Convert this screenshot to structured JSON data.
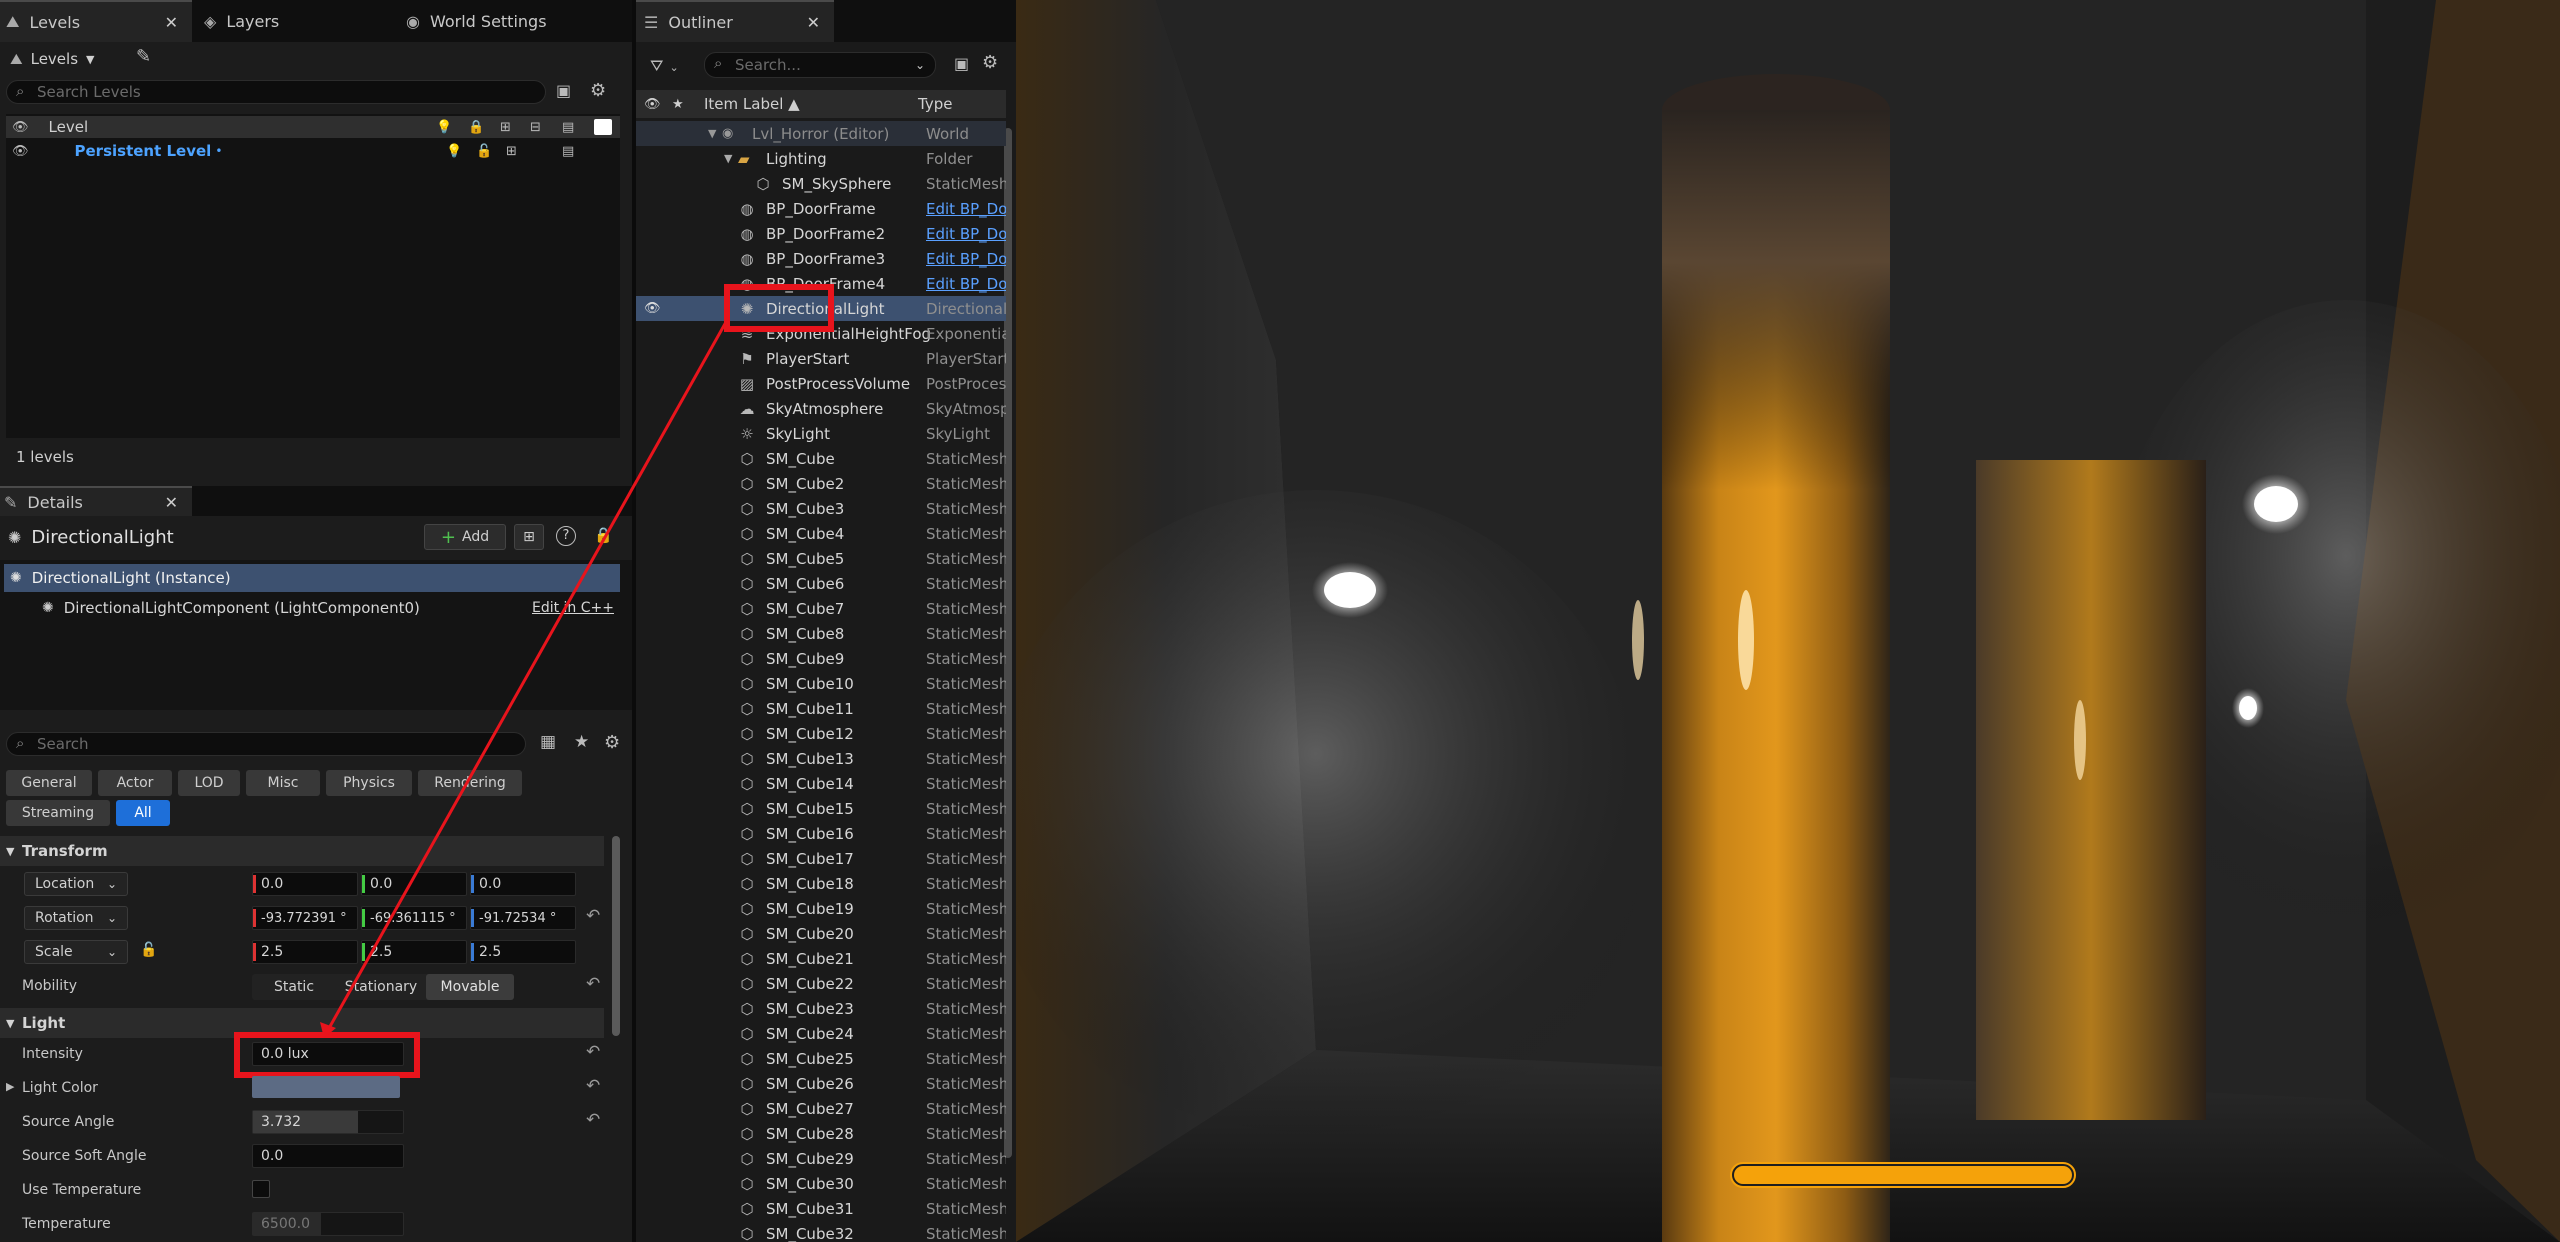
{
  "levels_panel": {
    "tabs": [
      {
        "label": "Levels",
        "icon": "levels-icon"
      },
      {
        "label": "Layers",
        "icon": "layers-icon"
      },
      {
        "label": "World Settings",
        "icon": "globe-icon"
      }
    ],
    "toolbar_dropdown": "Levels",
    "search_placeholder": "Search Levels",
    "column_header": "Level",
    "persistent_level": "Persistent Level",
    "footer": "1 levels"
  },
  "details_panel": {
    "tab_label": "Details",
    "actor_name": "DirectionalLight",
    "add_button": "Add",
    "instance_row": "DirectionalLight (Instance)",
    "component_row": "DirectionalLightComponent (LightComponent0)",
    "edit_link": "Edit in C++",
    "search_placeholder": "Search",
    "categories_row1": [
      "General",
      "Actor",
      "LOD",
      "Misc",
      "Physics",
      "Rendering"
    ],
    "categories_row2": [
      "Streaming",
      "All"
    ],
    "transform": {
      "header": "Transform",
      "location_label": "Location",
      "location": [
        "0.0",
        "0.0",
        "0.0"
      ],
      "rotation_label": "Rotation",
      "rotation": [
        "-93.772391 °",
        "-69.361115 °",
        "-91.72534 °"
      ],
      "scale_label": "Scale",
      "scale": [
        "2.5",
        "2.5",
        "2.5"
      ],
      "mobility_label": "Mobility",
      "mobility_options": [
        "Static",
        "Stationary",
        "Movable"
      ],
      "mobility_selected": "Movable"
    },
    "light": {
      "header": "Light",
      "intensity_label": "Intensity",
      "intensity": "0.0 lux",
      "light_color_label": "Light Color",
      "source_angle_label": "Source Angle",
      "source_angle": "3.732",
      "source_soft_angle_label": "Source Soft Angle",
      "source_soft_angle": "0.0",
      "use_temperature_label": "Use Temperature",
      "temperature_label": "Temperature",
      "temperature": "6500.0"
    }
  },
  "outliner": {
    "tab_label": "Outliner",
    "search_placeholder": "Search...",
    "col_item_label": "Item Label ▲",
    "col_type": "Type",
    "world_row": {
      "label": "Lvl_Horror (Editor)",
      "type": "World"
    },
    "folder_row": {
      "label": "Lighting",
      "type": "Folder"
    },
    "items": [
      {
        "label": "SM_SkySphere",
        "type": "StaticMesh",
        "icon": "mesh-icon",
        "indent": 2
      },
      {
        "label": "BP_DoorFrame",
        "type": "Edit BP_DoorFrame",
        "icon": "blueprint-icon",
        "link": true
      },
      {
        "label": "BP_DoorFrame2",
        "type": "Edit BP_DoorFrame",
        "icon": "blueprint-icon",
        "link": true
      },
      {
        "label": "BP_DoorFrame3",
        "type": "Edit BP_DoorFrame",
        "icon": "blueprint-icon",
        "link": true
      },
      {
        "label": "BP_DoorFrame4",
        "type": "Edit BP_DoorFrame",
        "icon": "blueprint-icon",
        "link": true
      },
      {
        "label": "DirectionalLight",
        "type": "DirectionalLight",
        "icon": "sun-icon",
        "selected": true
      },
      {
        "label": "ExponentialHeightFog",
        "type": "ExponentialHeightFog",
        "icon": "fog-icon"
      },
      {
        "label": "PlayerStart",
        "type": "PlayerStart",
        "icon": "player-start-icon"
      },
      {
        "label": "PostProcessVolume",
        "type": "PostProcessVolume",
        "icon": "volume-icon"
      },
      {
        "label": "SkyAtmosphere",
        "type": "SkyAtmosphere",
        "icon": "atmosphere-icon"
      },
      {
        "label": "SkyLight",
        "type": "SkyLight",
        "icon": "skylight-icon"
      },
      {
        "label": "SM_Cube",
        "type": "StaticMesh",
        "icon": "mesh-icon"
      },
      {
        "label": "SM_Cube2",
        "type": "StaticMesh",
        "icon": "mesh-icon"
      },
      {
        "label": "SM_Cube3",
        "type": "StaticMesh",
        "icon": "mesh-icon"
      },
      {
        "label": "SM_Cube4",
        "type": "StaticMesh",
        "icon": "mesh-icon"
      },
      {
        "label": "SM_Cube5",
        "type": "StaticMesh",
        "icon": "mesh-icon"
      },
      {
        "label": "SM_Cube6",
        "type": "StaticMesh",
        "icon": "mesh-icon"
      },
      {
        "label": "SM_Cube7",
        "type": "StaticMesh",
        "icon": "mesh-icon"
      },
      {
        "label": "SM_Cube8",
        "type": "StaticMesh",
        "icon": "mesh-icon"
      },
      {
        "label": "SM_Cube9",
        "type": "StaticMesh",
        "icon": "mesh-icon"
      },
      {
        "label": "SM_Cube10",
        "type": "StaticMesh",
        "icon": "mesh-icon"
      },
      {
        "label": "SM_Cube11",
        "type": "StaticMesh",
        "icon": "mesh-icon"
      },
      {
        "label": "SM_Cube12",
        "type": "StaticMesh",
        "icon": "mesh-icon"
      },
      {
        "label": "SM_Cube13",
        "type": "StaticMesh",
        "icon": "mesh-icon"
      },
      {
        "label": "SM_Cube14",
        "type": "StaticMesh",
        "icon": "mesh-icon"
      },
      {
        "label": "SM_Cube15",
        "type": "StaticMesh",
        "icon": "mesh-icon"
      },
      {
        "label": "SM_Cube16",
        "type": "StaticMesh",
        "icon": "mesh-icon"
      },
      {
        "label": "SM_Cube17",
        "type": "StaticMesh",
        "icon": "mesh-icon"
      },
      {
        "label": "SM_Cube18",
        "type": "StaticMesh",
        "icon": "mesh-icon"
      },
      {
        "label": "SM_Cube19",
        "type": "StaticMesh",
        "icon": "mesh-icon"
      },
      {
        "label": "SM_Cube20",
        "type": "StaticMesh",
        "icon": "mesh-icon"
      },
      {
        "label": "SM_Cube21",
        "type": "StaticMesh",
        "icon": "mesh-icon"
      },
      {
        "label": "SM_Cube22",
        "type": "StaticMesh",
        "icon": "mesh-icon"
      },
      {
        "label": "SM_Cube23",
        "type": "StaticMesh",
        "icon": "mesh-icon"
      },
      {
        "label": "SM_Cube24",
        "type": "StaticMesh",
        "icon": "mesh-icon"
      },
      {
        "label": "SM_Cube25",
        "type": "StaticMesh",
        "icon": "mesh-icon"
      },
      {
        "label": "SM_Cube26",
        "type": "StaticMesh",
        "icon": "mesh-icon"
      },
      {
        "label": "SM_Cube27",
        "type": "StaticMesh",
        "icon": "mesh-icon"
      },
      {
        "label": "SM_Cube28",
        "type": "StaticMesh",
        "icon": "mesh-icon"
      },
      {
        "label": "SM_Cube29",
        "type": "StaticMesh",
        "icon": "mesh-icon"
      },
      {
        "label": "SM_Cube30",
        "type": "StaticMesh",
        "icon": "mesh-icon"
      },
      {
        "label": "SM_Cube31",
        "type": "StaticMesh",
        "icon": "mesh-icon"
      },
      {
        "label": "SM_Cube32",
        "type": "StaticMesh",
        "icon": "mesh-icon"
      }
    ]
  },
  "viewport": {
    "progress_fill": 1.0,
    "accent": "#f5a20a"
  },
  "colors": {
    "highlight_box": "#e8141c",
    "selection": "#3d5170",
    "link": "#5aa0ff",
    "active_button": "#1e6fd9"
  }
}
